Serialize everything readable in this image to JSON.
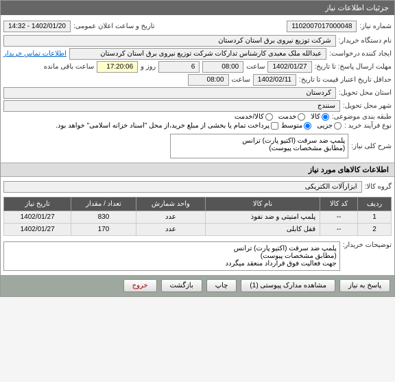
{
  "header": {
    "title": "جزئیات اطلاعات نیاز"
  },
  "fields": {
    "need_number_label": "شماره نیاز:",
    "need_number": "1102007017000048",
    "announce_label": "تاریخ و ساعت اعلان عمومی:",
    "announce_value": "1402/01/20 - 14:32",
    "buyer_label": "نام دستگاه خریدار:",
    "buyer_value": "شرکت توزیع نیروی برق استان کردستان",
    "creator_label": "ایجاد کننده درخواست:",
    "creator_value": "عبدالله ملک معبدی کارشناس تدارکات شرکت توزیع نیروی برق استان کردستان",
    "contact_link": "اطلاعات تماس خریدار",
    "deadline_label": "مهلت ارسال پاسخ: تا تاریخ:",
    "deadline_date": "1402/01/27",
    "time_label": "ساعت",
    "deadline_time": "08:00",
    "days_label": "روز و",
    "days_value": "6",
    "remaining_label": "ساعت باقی مانده",
    "remaining_time": "17:20:06",
    "validity_label": "حداقل تاریخ اعتبار قیمت تا تاریخ:",
    "validity_date": "1402/02/11",
    "validity_time": "08:00",
    "province_label": "استان محل تحویل:",
    "province_value": "کردستان",
    "city_label": "شهر محل تحویل:",
    "city_value": "سنندج",
    "category_label": "طبقه بندی موضوعی:",
    "cat_goods": "کالا",
    "cat_service": "خدمت",
    "cat_both": "کالا/خدمت",
    "process_label": "نوع فرآیند خرید :",
    "proc_small": "جزیی",
    "proc_medium": "متوسط",
    "proc_note": "پرداخت تمام یا بخشی از مبلغ خرید،از محل \"اسناد خزانه اسلامی\" خواهد بود.",
    "desc_label": "شرح کلی نیاز:",
    "desc_value": "پلمپ ضد سرقت (اکتیو پارت) ترانس\n(مطابق مشخصات پیوست)",
    "goods_section": "اطلاعات کالاهای مورد نیاز",
    "group_label": "گروه کالا:",
    "group_value": "ابزارآلات الکتریکی",
    "buyer_desc_label": "توضیحات خریدار:",
    "buyer_desc_value": "پلمپ ضد سرقت (اکتیو پارت) ترانس\n(مطابق مشخصات پیوست)\nجهت فعالیت فوق قرارداد منعقد میگردد"
  },
  "table": {
    "headers": {
      "row": "ردیف",
      "code": "کد کالا",
      "name": "نام کالا",
      "unit": "واحد شمارش",
      "qty": "تعداد / مقدار",
      "date": "تاریخ نیاز"
    },
    "rows": [
      {
        "n": "1",
        "code": "--",
        "name": "پلمپ امنیتی و ضد نفوذ",
        "unit": "عدد",
        "qty": "830",
        "date": "1402/01/27"
      },
      {
        "n": "2",
        "code": "--",
        "name": "قفل کابلی",
        "unit": "عدد",
        "qty": "170",
        "date": "1402/01/27"
      }
    ]
  },
  "footer": {
    "reply": "پاسخ به نیاز",
    "attachments": "مشاهده مدارک پیوستی (1)",
    "print": "چاپ",
    "back": "بازگشت",
    "exit": "خروج"
  }
}
